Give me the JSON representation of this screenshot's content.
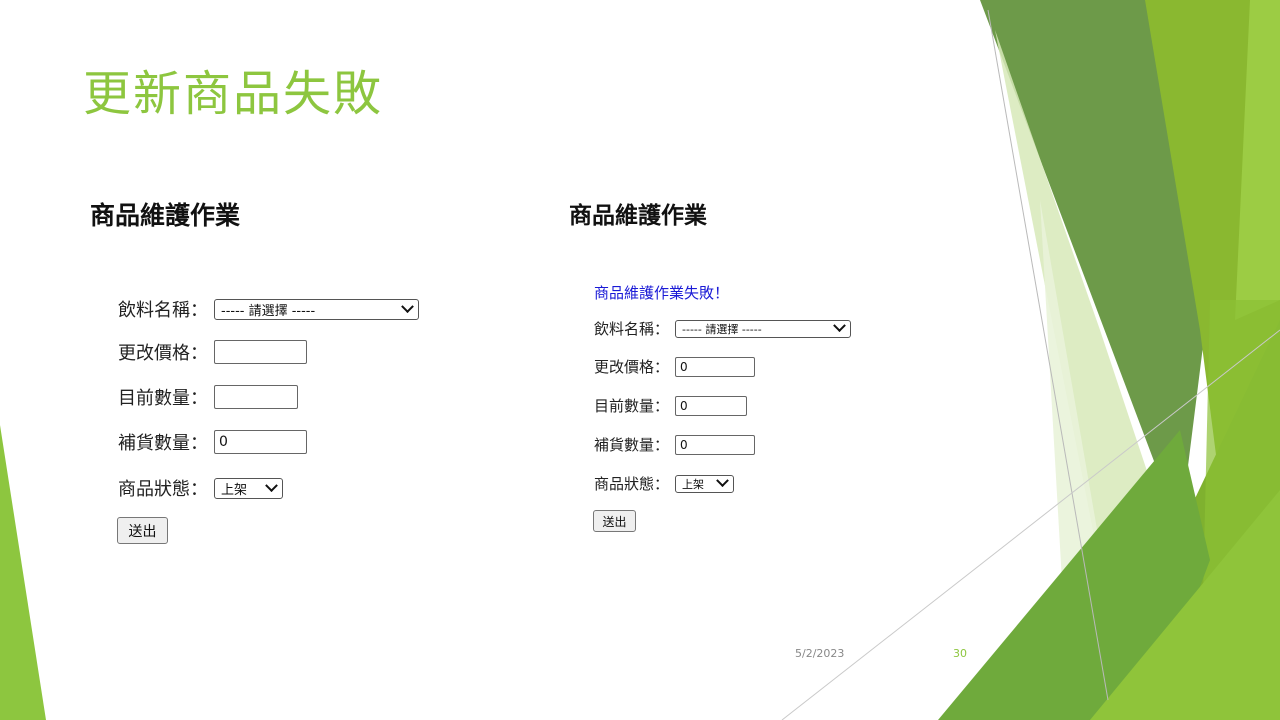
{
  "slide": {
    "title": "更新商品失敗",
    "footer_date": "5/2/2023",
    "footer_page": "30"
  },
  "colors": {
    "accent_green": "#8dc63f",
    "error_blue": "#1a1ad6"
  },
  "left_panel": {
    "heading": "商品維護作業",
    "drink_label": "飲料名稱：",
    "drink_selected": "----- 請選擇 -----",
    "price_label": "更改價格：",
    "price_value": "",
    "qty_label": "目前數量：",
    "qty_value": "",
    "restock_label": "補貨數量：",
    "restock_value": "0",
    "status_label": "商品狀態：",
    "status_selected": "上架",
    "submit_label": "送出"
  },
  "right_panel": {
    "heading": "商品維護作業",
    "error_message": "商品維護作業失敗！",
    "drink_label": "飲料名稱：",
    "drink_selected": "----- 請選擇 -----",
    "price_label": "更改價格：",
    "price_value": "0",
    "qty_label": "目前數量：",
    "qty_value": "0",
    "restock_label": "補貨數量：",
    "restock_value": "0",
    "status_label": "商品狀態：",
    "status_selected": "上架",
    "submit_label": "送出"
  }
}
